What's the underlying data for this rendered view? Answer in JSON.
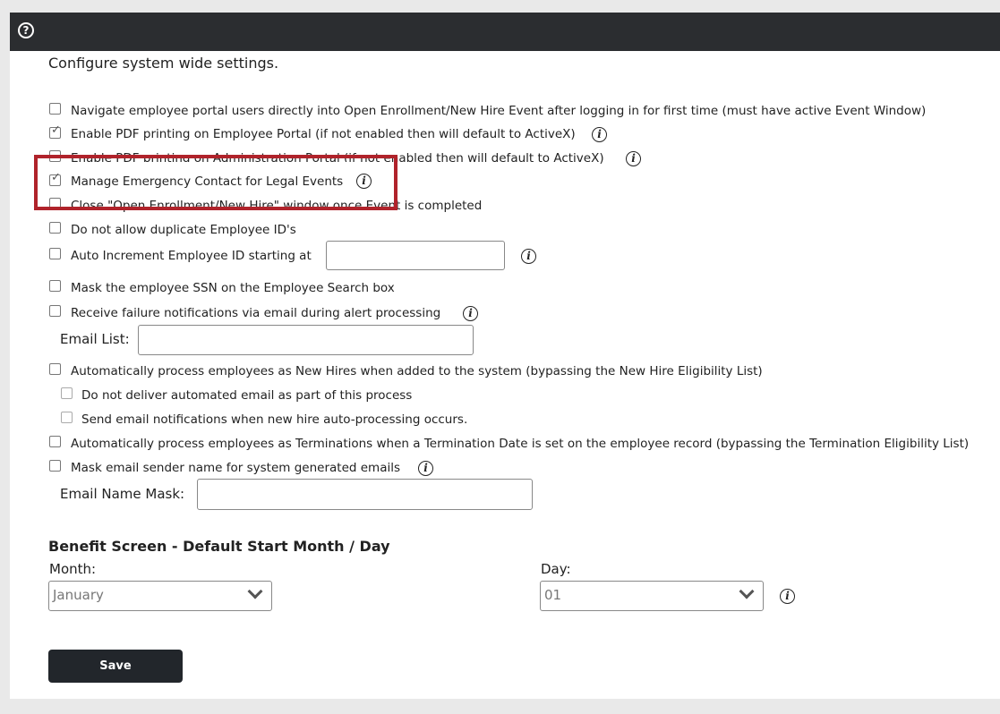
{
  "intro": "Configure system wide settings.",
  "settings": [
    {
      "label": "Navigate employee portal users directly into Open Enrollment/New Hire Event after logging in for first time (must have active Event Window)",
      "checked": false
    },
    {
      "label": "Enable PDF printing on Employee Portal (if not enabled then will default to ActiveX)",
      "checked": true
    },
    {
      "label": "Enable PDF printing on Administration Portal (if not enabled then will default to ActiveX)",
      "checked": false
    },
    {
      "label": "Manage Emergency Contact for Legal Events",
      "checked": true
    },
    {
      "label": "Close \"Open Enrollment/New Hire\" window once Event is completed",
      "checked": false
    },
    {
      "label": "Do not allow duplicate Employee ID's",
      "checked": false
    },
    {
      "label": "Auto Increment Employee ID starting at",
      "checked": false
    },
    {
      "label": "Mask the employee SSN on the Employee Search box",
      "checked": false
    },
    {
      "label": "Receive failure notifications via email during alert processing",
      "checked": false
    },
    {
      "label": "Automatically process employees as New Hires when added to the system (bypassing the New Hire Eligibility List)",
      "checked": false
    },
    {
      "label": "Do not deliver automated email as part of this process",
      "checked": false
    },
    {
      "label": "Send email notifications when new hire auto-processing occurs.",
      "checked": false
    },
    {
      "label": "Automatically process employees as Terminations when a Termination Date is set on the employee record (bypassing the Termination Eligibility List)",
      "checked": false
    },
    {
      "label": "Mask email sender name for system generated emails",
      "checked": false
    }
  ],
  "email_list_label": "Email List:",
  "email_name_mask_label": "Email Name Mask:",
  "benefit_section_title": "Benefit Screen - Default Start Month / Day",
  "month_label": "Month:",
  "month_value": "January",
  "day_label": "Day:",
  "day_value": "01",
  "save_label": "Save",
  "help_glyph": "?",
  "info_glyph": "i",
  "check_glyph": "✓",
  "colors": {
    "topbar": "#2b2d30",
    "highlight": "#b0232b",
    "button": "#22262b"
  }
}
